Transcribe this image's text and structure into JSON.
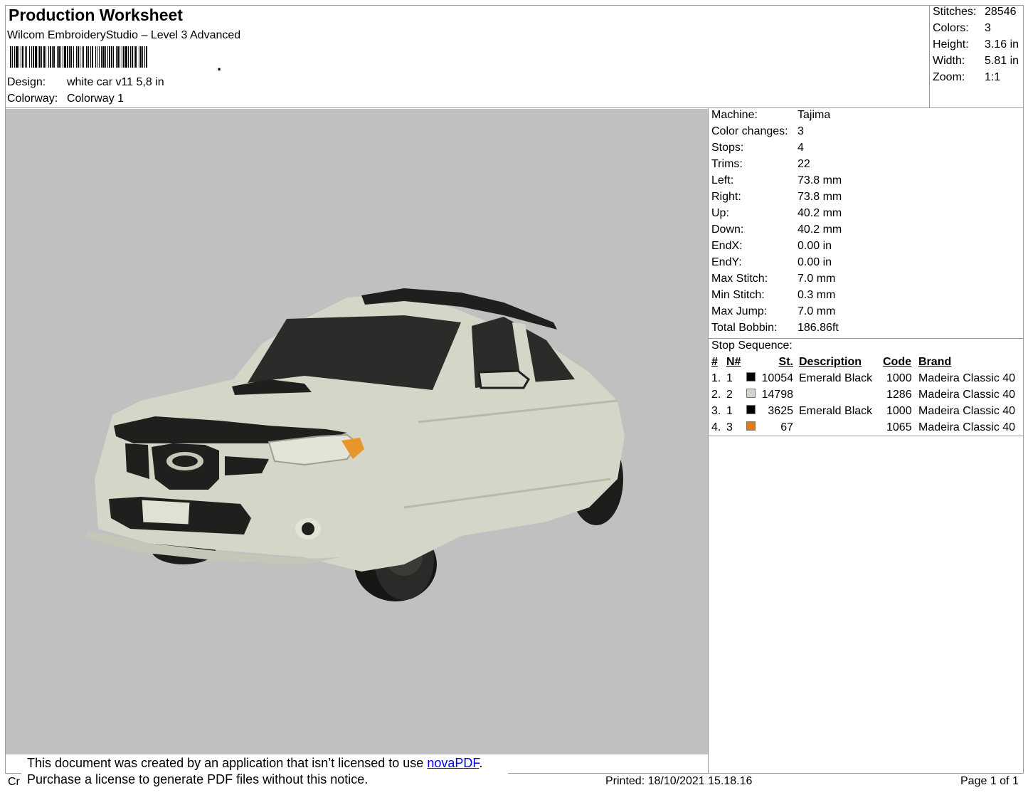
{
  "header": {
    "title": "Production Worksheet",
    "software": "Wilcom EmbroideryStudio – Level 3 Advanced",
    "design_label": "Design:",
    "design_value": "white car v11 5,8 in",
    "colorway_label": "Colorway:",
    "colorway_value": "Colorway 1"
  },
  "summary": [
    {
      "label": "Stitches:",
      "value": "28546"
    },
    {
      "label": "Colors:",
      "value": "3"
    },
    {
      "label": "Height:",
      "value": "3.16 in"
    },
    {
      "label": "Width:",
      "value": "5.81 in"
    },
    {
      "label": "Zoom:",
      "value": "1:1"
    }
  ],
  "machine_info": [
    {
      "label": "Machine:",
      "value": "Tajima"
    },
    {
      "label": "Color changes:",
      "value": "3"
    },
    {
      "label": "Stops:",
      "value": "4"
    },
    {
      "label": "Trims:",
      "value": "22"
    },
    {
      "label": "Left:",
      "value": "73.8 mm"
    },
    {
      "label": "Right:",
      "value": "73.8 mm"
    },
    {
      "label": "Up:",
      "value": "40.2 mm"
    },
    {
      "label": "Down:",
      "value": "40.2 mm"
    },
    {
      "label": "EndX:",
      "value": "0.00 in"
    },
    {
      "label": "EndY:",
      "value": "0.00 in"
    },
    {
      "label": "Max Stitch:",
      "value": "7.0 mm"
    },
    {
      "label": "Min Stitch:",
      "value": "0.3 mm"
    },
    {
      "label": "Max Jump:",
      "value": "7.0 mm"
    },
    {
      "label": "Total Bobbin:",
      "value": "186.86ft"
    }
  ],
  "stop_sequence": {
    "title": "Stop Sequence:",
    "headers": {
      "num": "#",
      "n": "N#",
      "st": "St.",
      "description": "Description",
      "code": "Code",
      "brand": "Brand"
    },
    "rows": [
      {
        "num": "1.",
        "n": "1",
        "color": "#000000",
        "st": "10054",
        "description": "Emerald Black",
        "code": "1000",
        "brand": "Madeira Classic 40"
      },
      {
        "num": "2.",
        "n": "2",
        "color": "#d4d2cb",
        "st": "14798",
        "description": "",
        "code": "1286",
        "brand": "Madeira Classic 40"
      },
      {
        "num": "3.",
        "n": "1",
        "color": "#000000",
        "st": "3625",
        "description": "Emerald Black",
        "code": "1000",
        "brand": "Madeira Classic 40"
      },
      {
        "num": "4.",
        "n": "3",
        "color": "#e07a1f",
        "st": "67",
        "description": "",
        "code": "1065",
        "brand": "Madeira Classic 40"
      }
    ]
  },
  "notice": {
    "line1_prefix": "This document was created by an application that isn’t licensed to use ",
    "link_text": "novaPDF",
    "line1_suffix": ".",
    "line2": "Purchase a license to generate PDF files without this notice."
  },
  "footer": {
    "cr": "Cr",
    "printed": "Printed: 18/10/2021 15.18.16",
    "page": "Page 1 of 1"
  },
  "colors": {
    "preview_bg": "#c0c0c0",
    "car_body": "#d6d7c9",
    "trim_black": "#1f201d",
    "indicator_orange": "#e8962b"
  }
}
